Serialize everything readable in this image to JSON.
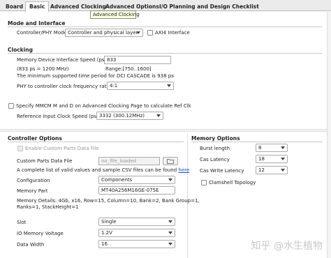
{
  "tabs": [
    "Board",
    "Basic",
    "Advanced Clocking",
    "Advanced Options",
    "I/O Planning and Design Checklist"
  ],
  "tooltip": "Advanced Clocking",
  "mode": {
    "heading": "Mode and Interface",
    "controller_label": "Controller/PHY Mode",
    "controller_value": "Controller and physical layer",
    "axi_label": "AXI4 Interface"
  },
  "clocking": {
    "heading": "Clocking",
    "speed_label": "Memory Device Interface Speed (ps)",
    "speed_value": "833",
    "speed_mhz": "(833 ps = 1200 MHz)",
    "range": "Range:[750..1600]",
    "min_period": "The minimum supported time period for DCI CASCADE is 938 ps",
    "ratio_label": "PHY to controller clock frequency ratio",
    "ratio_value": "4:1",
    "mmcm_label": "Specify MMCM M and D on Advanced Clocking Page to calculate Ref Clk",
    "ref_label": "Reference Input Clock Speed (ps)",
    "ref_value": "3332 (300.12MHz)"
  },
  "controller": {
    "heading": "Controller Options",
    "enable_custom": "Enable Custom Parts Data File",
    "custom_file_label": "Custom Parts Data File",
    "custom_file_value": "no_file_loaded",
    "csv_text": "A complete list of valid values and sample CSV files can be found",
    "csv_link": "here",
    "config_label": "Configuration",
    "config_value": "Components",
    "part_label": "Memory Part",
    "part_value": "MT40A256M16GE-075E",
    "details_line1": "Memory Details: 4Gb, x16, Row=15, Column=10, Bank=2, Bank Group=1,",
    "details_line2": "Ranks=1, StackHeight=1",
    "slot_label": "Slot",
    "slot_value": "Single",
    "voltage_label": "IO Memory Voltage",
    "voltage_value": "1.2V",
    "width_label": "Data Width",
    "width_value": "16"
  },
  "memory": {
    "heading": "Memory Options",
    "burst_label": "Burst length",
    "burst_value": "8",
    "cas_label": "Cas Latency",
    "cas_value": "18",
    "cwl_label": "Cas Write Latency",
    "cwl_value": "12",
    "clamshell_label": "Clamshell Topology"
  },
  "watermark": "知乎 @水生植物"
}
